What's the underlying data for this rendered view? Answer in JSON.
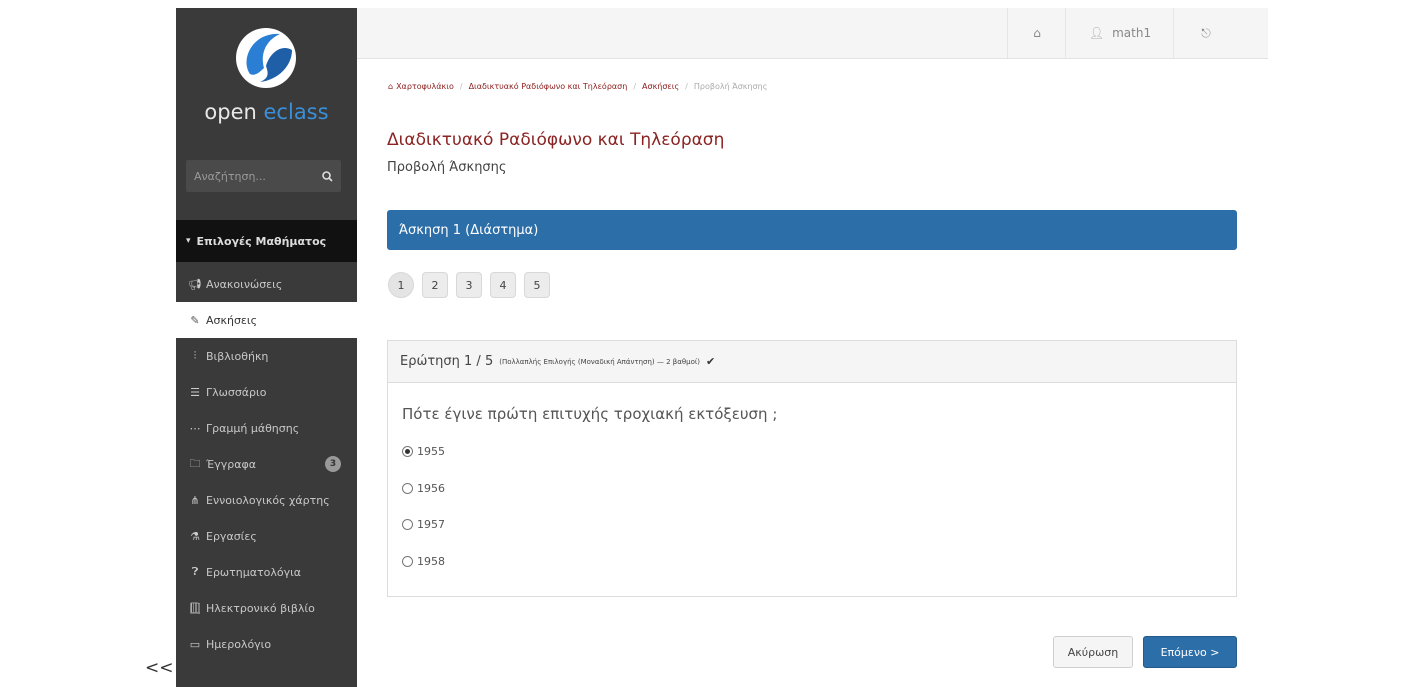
{
  "collapse_toggle": "<<",
  "sidebar": {
    "logo": {
      "text_main": "open ",
      "text_accent": "eclass",
      "accent_color": "#3a8fd8"
    },
    "search": {
      "placeholder": "Αναζήτηση...",
      "icon": "search-icon"
    },
    "course_menu_header": "Επιλογές Μαθήματος",
    "items": [
      {
        "label": "Ανακοινώσεις",
        "icon": "megaphone-icon",
        "active": false
      },
      {
        "label": "Ασκήσεις",
        "icon": "edit-icon",
        "active": true
      },
      {
        "label": "Βιβλιοθήκη",
        "icon": "library-icon",
        "active": false
      },
      {
        "label": "Γλωσσάριο",
        "icon": "list-icon",
        "active": false
      },
      {
        "label": "Γραμμή μάθησης",
        "icon": "ellipsis-icon",
        "active": false
      },
      {
        "label": "Έγγραφα",
        "icon": "folder-icon",
        "active": false,
        "badge": "3"
      },
      {
        "label": "Εννοιολογικός χάρτης",
        "icon": "sitemap-icon",
        "active": false
      },
      {
        "label": "Εργασίες",
        "icon": "flask-icon",
        "active": false
      },
      {
        "label": "Ερωτηματολόγια",
        "icon": "question-icon",
        "active": false
      },
      {
        "label": "Ηλεκτρονικό βιβλίο",
        "icon": "book-icon",
        "active": false
      },
      {
        "label": "Ημερολόγιο",
        "icon": "calendar-icon",
        "active": false
      }
    ]
  },
  "topbar": {
    "home_icon": "home-icon",
    "user_name": "math1",
    "user_icon": "user-icon",
    "exit_icon": "logout-icon"
  },
  "breadcrumb": {
    "items": [
      "Χαρτοφυλάκιο",
      "Διαδικτυακό Ραδιόφωνο και Τηλεόραση",
      "Ασκήσεις"
    ],
    "current": "Προβολή Άσκησης"
  },
  "page": {
    "title": "Διαδικτυακό Ραδιόφωνο και Τηλεόραση",
    "subtitle": "Προβολή Άσκησης"
  },
  "exercise": {
    "title": "Άσκηση 1 (Διάστημα)",
    "pages": [
      "1",
      "2",
      "3",
      "4",
      "5"
    ],
    "current_page": "1"
  },
  "question": {
    "number": "Ερώτηση 1 / 5",
    "meta": "(Πολλαπλής Επιλογής (Μοναδική Απάντηση) — 2 βαθμοί)",
    "text": "Πότε έγινε πρώτη επιτυχής τροχιακή εκτόξευση ;",
    "options": [
      {
        "label": "1955",
        "checked": true
      },
      {
        "label": "1956",
        "checked": false
      },
      {
        "label": "1957",
        "checked": false
      },
      {
        "label": "1958",
        "checked": false
      }
    ]
  },
  "actions": {
    "cancel_label": "Ακύρωση",
    "next_label": "Επόμενο >"
  },
  "colors": {
    "primary": "#2c6ea8",
    "title": "#8b2323",
    "sidebar_bg": "#3a3a3a"
  }
}
